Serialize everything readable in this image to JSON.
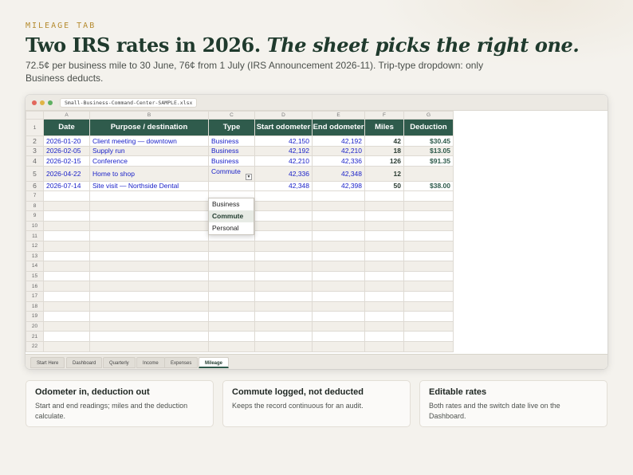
{
  "eyebrow": "MILEAGE TAB",
  "headline": {
    "main": "Two IRS rates in 2026.",
    "italic": "The sheet picks the right one."
  },
  "subtitle": "72.5¢ per business mile to 30 June, 76¢ from 1 July (IRS Announcement 2026-11). Trip-type dropdown: only Business deducts.",
  "window": {
    "filename": "Small-Business-Command-Center-SAMPLE.xlsx"
  },
  "columns": [
    "A",
    "B",
    "C",
    "D",
    "E",
    "F",
    "G"
  ],
  "headers": [
    "Date",
    "Purpose / destination",
    "Type",
    "Start odometer",
    "End odometer",
    "Miles",
    "Deduction"
  ],
  "rows": [
    {
      "num": "2",
      "date": "2026-01-20",
      "purpose": "Client meeting — downtown",
      "type": "Business",
      "start": "42,150",
      "end": "42,192",
      "miles": "42",
      "deduction": "$30.45"
    },
    {
      "num": "3",
      "date": "2026-02-05",
      "purpose": "Supply run",
      "type": "Business",
      "start": "42,192",
      "end": "42,210",
      "miles": "18",
      "deduction": "$13.05"
    },
    {
      "num": "4",
      "date": "2026-02-15",
      "purpose": "Conference",
      "type": "Business",
      "start": "42,210",
      "end": "42,336",
      "miles": "126",
      "deduction": "$91.35"
    },
    {
      "num": "5",
      "date": "2026-04-22",
      "purpose": "Home to shop",
      "type": "Commute",
      "start": "42,336",
      "end": "42,348",
      "miles": "12",
      "deduction": ""
    },
    {
      "num": "6",
      "date": "2026-07-14",
      "purpose": "Site visit — Northside Dental",
      "type": "",
      "start": "42,348",
      "end": "42,398",
      "miles": "50",
      "deduction": "$38.00"
    }
  ],
  "empty_rows": [
    "7",
    "8",
    "9",
    "10",
    "11",
    "12",
    "13",
    "14",
    "15",
    "16",
    "17",
    "18",
    "19",
    "20",
    "21",
    "22"
  ],
  "header_row_num": "1",
  "dropdown": {
    "options": [
      "Business",
      "Commute",
      "Personal"
    ],
    "selected": "Commute"
  },
  "sheet_tabs": [
    "Start Here",
    "Dashboard",
    "Quarterly",
    "Income",
    "Expenses",
    "Mileage"
  ],
  "active_tab": "Mileage",
  "cards": [
    {
      "title": "Odometer in, deduction out",
      "body": "Start and end readings; miles and the deduction calculate."
    },
    {
      "title": "Commute logged, not deducted",
      "body": "Keeps the record continuous for an audit."
    },
    {
      "title": "Editable rates",
      "body": "Both rates and the switch date live on the Dashboard."
    }
  ],
  "colors": {
    "accent": "#2f5b4c",
    "eyebrow": "#b58b2f",
    "input_blue": "#1c23c9"
  }
}
